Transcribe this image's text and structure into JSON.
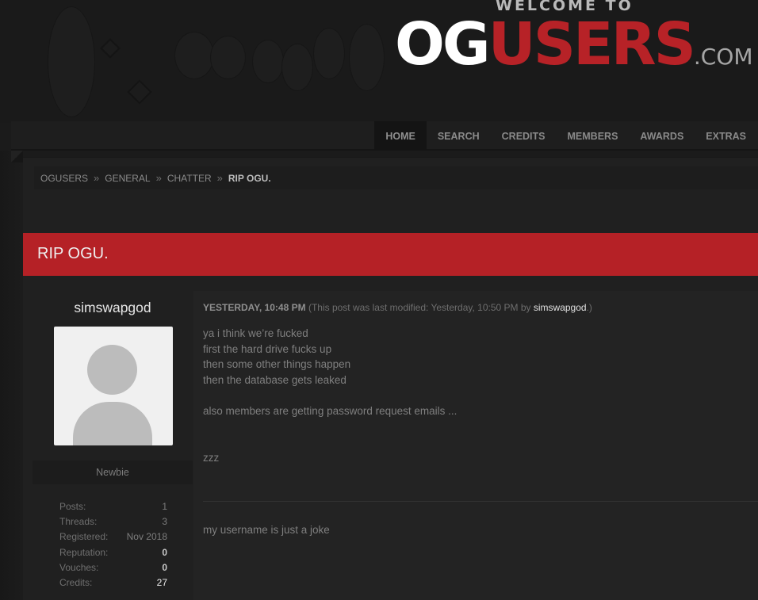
{
  "header": {
    "logo_welcome": "WELCOME TO",
    "logo_og": "OG",
    "logo_users": "USERS",
    "logo_com": ".COM"
  },
  "nav": {
    "items": [
      {
        "label": "HOME",
        "active": true
      },
      {
        "label": "SEARCH"
      },
      {
        "label": "CREDITS"
      },
      {
        "label": "MEMBERS"
      },
      {
        "label": "AWARDS"
      },
      {
        "label": "EXTRAS"
      }
    ]
  },
  "breadcrumb": {
    "items": [
      "OGUSERS",
      "GENERAL",
      "CHATTER"
    ],
    "current": "RIP OGU.",
    "separator": "»"
  },
  "thread": {
    "title": "RIP OGU.",
    "accent_color": "#b52126"
  },
  "post": {
    "author": {
      "username": "simswapgod",
      "usergroup": "Newbie",
      "avatar_icon": "default-avatar-icon",
      "stats": [
        {
          "label": "Posts:",
          "value": "1"
        },
        {
          "label": "Threads:",
          "value": "3"
        },
        {
          "label": "Registered:",
          "value": "Nov 2018"
        },
        {
          "label": "Reputation:",
          "value": "0"
        },
        {
          "label": "Vouches:",
          "value": "0"
        },
        {
          "label": "Credits:",
          "value": "27"
        }
      ]
    },
    "date": "YESTERDAY, 10:48 PM",
    "edit_prefix": "(This post was last modified: Yesterday, 10:50 PM by ",
    "edit_user": "simswapgod",
    "edit_suffix": ".)",
    "lines": [
      "ya i think we’re fucked",
      "first the hard drive fucks up",
      "then some other things happen",
      "then the database gets leaked",
      "also members are getting password request emails ...",
      "zzz"
    ],
    "signature": "my username is just a joke"
  }
}
